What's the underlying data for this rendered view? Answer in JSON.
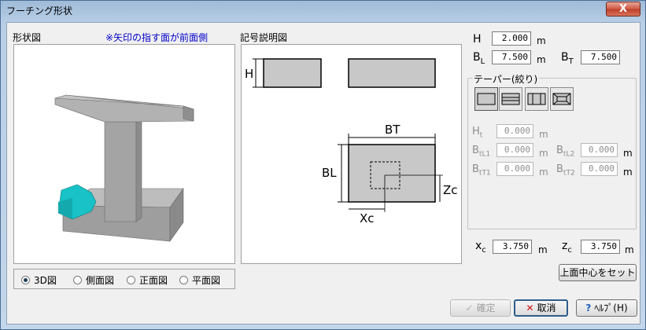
{
  "window": {
    "title": "フーチング形状",
    "close_label": "X"
  },
  "shape_panel": {
    "label": "形状図",
    "note": "※矢印の指す面が前面側"
  },
  "legend_panel": {
    "label": "記号説明図"
  },
  "diagram": {
    "h_label": "H",
    "bt_label": "BT",
    "bl_label": "BL",
    "zc_label": "Zc",
    "xc_label": "Xc"
  },
  "fields": {
    "H": {
      "label": "H",
      "value": "2.000",
      "unit": "m"
    },
    "BL": {
      "label": "B",
      "sub": "L",
      "value": "7.500",
      "unit": "m"
    },
    "BT": {
      "label": "B",
      "sub": "T",
      "value": "7.500"
    },
    "Ht": {
      "label": "H",
      "sub": "t",
      "value": "0.000",
      "unit": "m"
    },
    "BtL1": {
      "label": "B",
      "sub": "tL1",
      "value": "0.000",
      "unit": "m"
    },
    "BtL2": {
      "label": "B",
      "sub": "tL2",
      "value": "0.000",
      "unit": "m"
    },
    "BtT1": {
      "label": "B",
      "sub": "tT1",
      "value": "0.000",
      "unit": "m"
    },
    "BtT2": {
      "label": "B",
      "sub": "tT2",
      "value": "0.000",
      "unit": "m"
    },
    "xc": {
      "label": "x",
      "sub": "c",
      "value": "3.750",
      "unit": "m"
    },
    "zc": {
      "label": "z",
      "sub": "c",
      "value": "3.750",
      "unit": "m"
    }
  },
  "taper": {
    "label": "テーパー(絞り)"
  },
  "view_options": [
    "3D図",
    "側面図",
    "正面図",
    "平面図"
  ],
  "selected_view": "3D図",
  "buttons": {
    "center": "上面中心をセット",
    "ok": "確定",
    "cancel": "取消",
    "help": "ﾍﾙﾌﾟ(H)"
  },
  "colors": {
    "member": "#a6a6a6",
    "arrow": "#19c2c6",
    "diagram_fill": "#c8c8c8"
  }
}
